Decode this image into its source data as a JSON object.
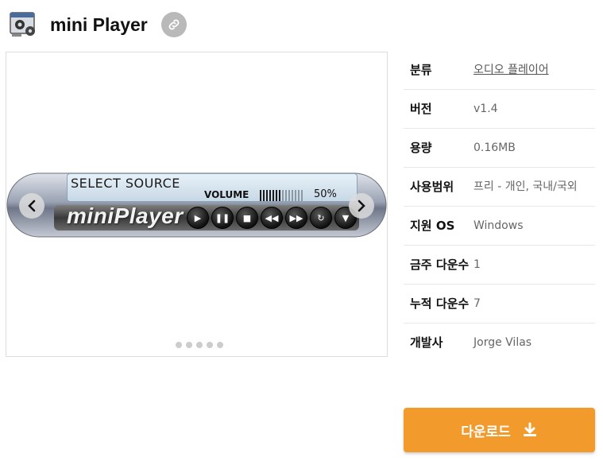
{
  "app": {
    "title": "mini Player",
    "icon": "gear-window-icon",
    "link_icon": "link-icon"
  },
  "screenshot_skin": {
    "lcd_source": "SELECT SOURCE",
    "lcd_volume_label": "VOLUME",
    "lcd_volume_level": 0.5,
    "lcd_volume_text": "50%",
    "logo_text": "miniPlayer",
    "controls": [
      "play-icon",
      "pause-icon",
      "stop-icon",
      "rewind-icon",
      "fast-forward-icon",
      "repeat-icon",
      "menu-icon"
    ]
  },
  "carousel": {
    "prev_icon": "chevron-left-icon",
    "next_icon": "chevron-right-icon",
    "dot_count": 5
  },
  "info": {
    "rows": [
      {
        "label": "분류",
        "value": "오디오 플레이어",
        "is_link": true
      },
      {
        "label": "버전",
        "value": "v1.4",
        "is_link": false
      },
      {
        "label": "용량",
        "value": "0.16MB",
        "is_link": false
      },
      {
        "label": "사용범위",
        "value": "프리 - 개인, 국내/국외",
        "is_link": false
      },
      {
        "label": "지원 OS",
        "value": "Windows",
        "is_link": false
      },
      {
        "label": "금주 다운수",
        "value": "1",
        "is_link": false
      },
      {
        "label": "누적 다운수",
        "value": "7",
        "is_link": false
      },
      {
        "label": "개발사",
        "value": "Jorge Vilas",
        "is_link": false
      }
    ]
  },
  "download": {
    "label": "다운로드",
    "icon": "download-icon",
    "color": "#f39a2c"
  }
}
